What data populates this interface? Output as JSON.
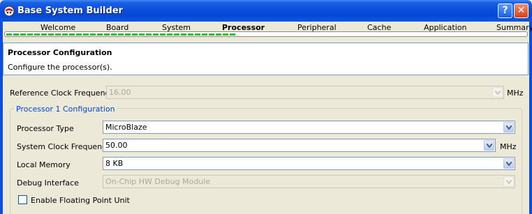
{
  "window": {
    "title": "Base System Builder",
    "help_label": "?",
    "close_label": "✕"
  },
  "steps": {
    "items": [
      "Welcome",
      "Board",
      "System",
      "Processor",
      "Peripheral",
      "Cache",
      "Application",
      "Summary"
    ],
    "active": "Processor",
    "progress_percent": 44
  },
  "header": {
    "title": "Processor Configuration",
    "subtitle": "Configure the processor(s)."
  },
  "form": {
    "ref_clock": {
      "label": "Reference Clock Frequency",
      "value": "16.00",
      "unit": "MHz",
      "enabled": false
    },
    "group_title": "Processor 1 Configuration",
    "processor_type": {
      "label": "Processor Type",
      "value": "MicroBlaze",
      "enabled": true
    },
    "system_clock": {
      "label": "System Clock Frequency",
      "value": "50.00",
      "unit": "MHz",
      "enabled": true
    },
    "local_memory": {
      "label": "Local Memory",
      "value": "8 KB",
      "enabled": true
    },
    "debug_interface": {
      "label": "Debug Interface",
      "value": "On-Chip HW Debug Module",
      "enabled": false
    },
    "fpu": {
      "label": "Enable Floating Point Unit",
      "checked": false
    }
  },
  "icons": {
    "app": "xilinx-icon",
    "combo_arrow": "chevron-down-icon"
  },
  "colors": {
    "titlebar": "#0a4fdc",
    "progress": "#2fbb2f",
    "group_title": "#0046d5"
  }
}
